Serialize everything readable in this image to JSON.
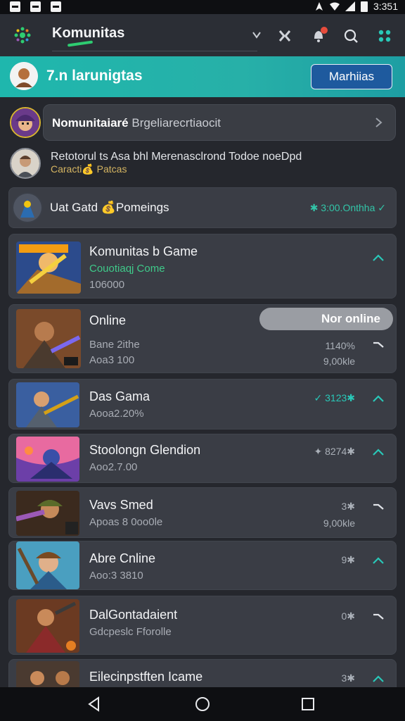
{
  "status_bar": {
    "time": "3:351"
  },
  "header": {
    "title": "Komunitas"
  },
  "banner": {
    "title": "7.n larunigtas",
    "button_label": "Marhiias"
  },
  "post_prompt": {
    "title": "Nomunitaiaré",
    "placeholder": "Brgeliarecrtiaocit"
  },
  "activity": {
    "line1": "Retotorul ts Asa bhl Merenasclrond Todoe noeDpd",
    "line2": "Caracti💰 Patcas"
  },
  "featured": {
    "label": "Uat Gatd 💰Pomeings",
    "status": "✱ 3:00.Onthha ✓"
  },
  "games": [
    {
      "name": "Komunitas b Game",
      "sub": "Couotiaqj Come",
      "meta": "106000",
      "right_top": "",
      "right_bottom": ""
    },
    {
      "name": "Online",
      "pill": "Nor online",
      "sub": "Bane 2ithe",
      "meta": "Aoa3 100",
      "right_top": "1140%",
      "right_bottom": "9,00kle"
    },
    {
      "name": "Das Gama",
      "sub": "Aooa2.20%",
      "meta": "",
      "right_top": "✓ 3123✱",
      "right_bottom": ""
    },
    {
      "name": "Stoolongn Glendion",
      "sub": "Aoo2.7.00",
      "meta": "",
      "right_top": "✦ 8274✱",
      "right_bottom": ""
    },
    {
      "name": "Vavs Smed",
      "sub": "Apoas 8 0oo0le",
      "meta": "",
      "right_top": "3✱",
      "right_bottom": "9,00kle"
    },
    {
      "name": "Abre Cnline",
      "sub": "Aoo:3 3810",
      "meta": "",
      "right_top": "9✱",
      "right_bottom": ""
    },
    {
      "name": "DalGontadaient",
      "sub": "Gdcpeslc Fforolle",
      "meta": "",
      "right_top": "0✱",
      "right_bottom": ""
    },
    {
      "name": "Eilecinpstften Icame",
      "sub": "",
      "meta": "",
      "right_top": "3✱",
      "right_bottom": ""
    }
  ],
  "colors": {
    "accent_teal": "#1fb7ad",
    "button_blue": "#1e5a9e",
    "green": "#2ecc71",
    "card_bg": "#3a3d45"
  }
}
